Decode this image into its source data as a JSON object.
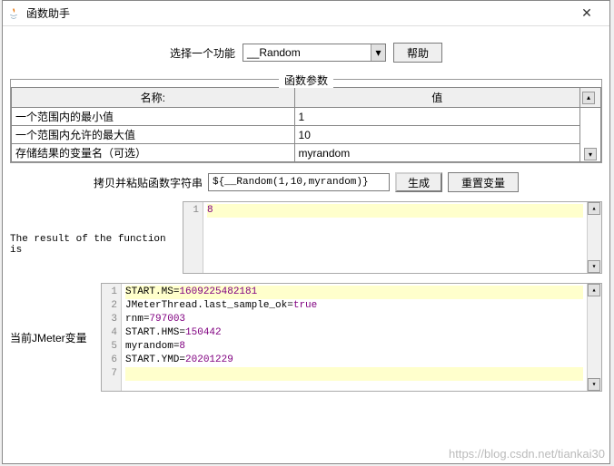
{
  "window": {
    "title": "函数助手"
  },
  "top": {
    "select_label": "选择一个功能",
    "selected_function": "__Random",
    "help_button": "帮助"
  },
  "params_section": {
    "title": "函数参数",
    "header_name": "名称:",
    "header_value": "值",
    "rows": [
      {
        "name": "一个范围内的最小值",
        "value": "1"
      },
      {
        "name": "一个范围内允许的最大值",
        "value": "10"
      },
      {
        "name": "存储结果的变量名（可选）",
        "value": "myrandom"
      }
    ]
  },
  "copy_row": {
    "label": "拷贝并粘贴函数字符串",
    "value": "${__Random(1,10,myrandom)}",
    "generate_button": "生成",
    "reset_button": "重置变量"
  },
  "result": {
    "label": "The result of the function is",
    "value": "8"
  },
  "vars": {
    "label": "当前JMeter变量",
    "lines": [
      {
        "key": "START.MS",
        "val": "1609225482181"
      },
      {
        "key": "JMeterThread.last_sample_ok",
        "val": "true"
      },
      {
        "key": "rnm",
        "val": "797003"
      },
      {
        "key": "START.HMS",
        "val": "150442"
      },
      {
        "key": "myrandom",
        "val": "8"
      },
      {
        "key": "START.YMD",
        "val": "20201229"
      }
    ]
  },
  "watermark": "https://blog.csdn.net/tiankai30"
}
